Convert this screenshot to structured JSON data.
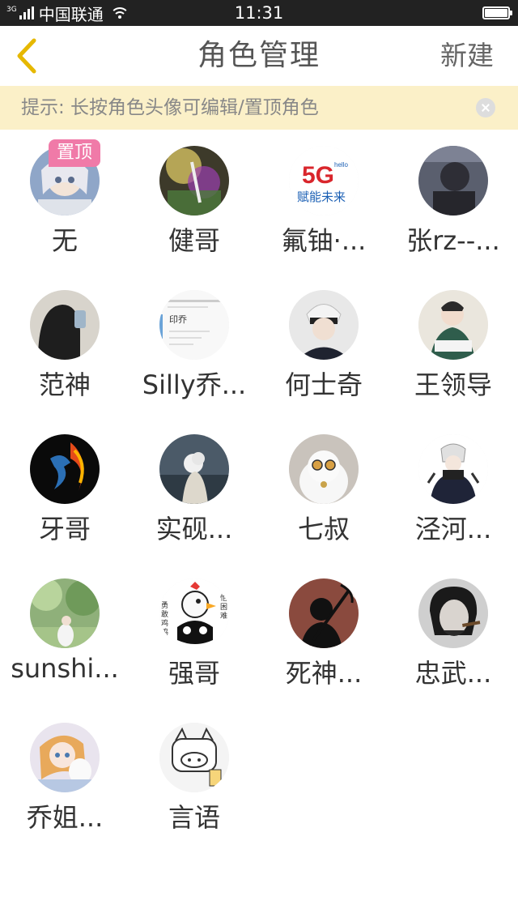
{
  "status_bar": {
    "network_type": "3G",
    "carrier": "中国联通",
    "time": "11:31"
  },
  "header": {
    "title": "角色管理",
    "new_label": "新建",
    "back_icon": "chevron-left-icon",
    "accent_color": "#e6b800"
  },
  "tip": {
    "text": "提示: 长按角色头像可编辑/置顶角色",
    "background": "#fbf0c8"
  },
  "pin_badge_label": "置顶",
  "roles": [
    {
      "name": "无"
    },
    {
      "name": "健哥"
    },
    {
      "name": "氟铀·..."
    },
    {
      "name": "张rz--..."
    },
    {
      "name": "范神"
    },
    {
      "name": "Silly乔..."
    },
    {
      "name": "何士奇"
    },
    {
      "name": "王领导"
    },
    {
      "name": "牙哥"
    },
    {
      "name": "实砚..."
    },
    {
      "name": "七叔"
    },
    {
      "name": "泾河..."
    },
    {
      "name": "sunshi..."
    },
    {
      "name": "强哥"
    },
    {
      "name": "死神..."
    },
    {
      "name": "忠武..."
    },
    {
      "name": "乔姐..."
    },
    {
      "name": "言语"
    }
  ],
  "avatar_texts": {
    "logo_5g": "5G",
    "logo_hello": "hello",
    "logo_slogan": "赋能未来",
    "doc_title": "印乔",
    "chicken_left": "勇敢鸡鸡",
    "chicken_right": "不怕困难"
  }
}
